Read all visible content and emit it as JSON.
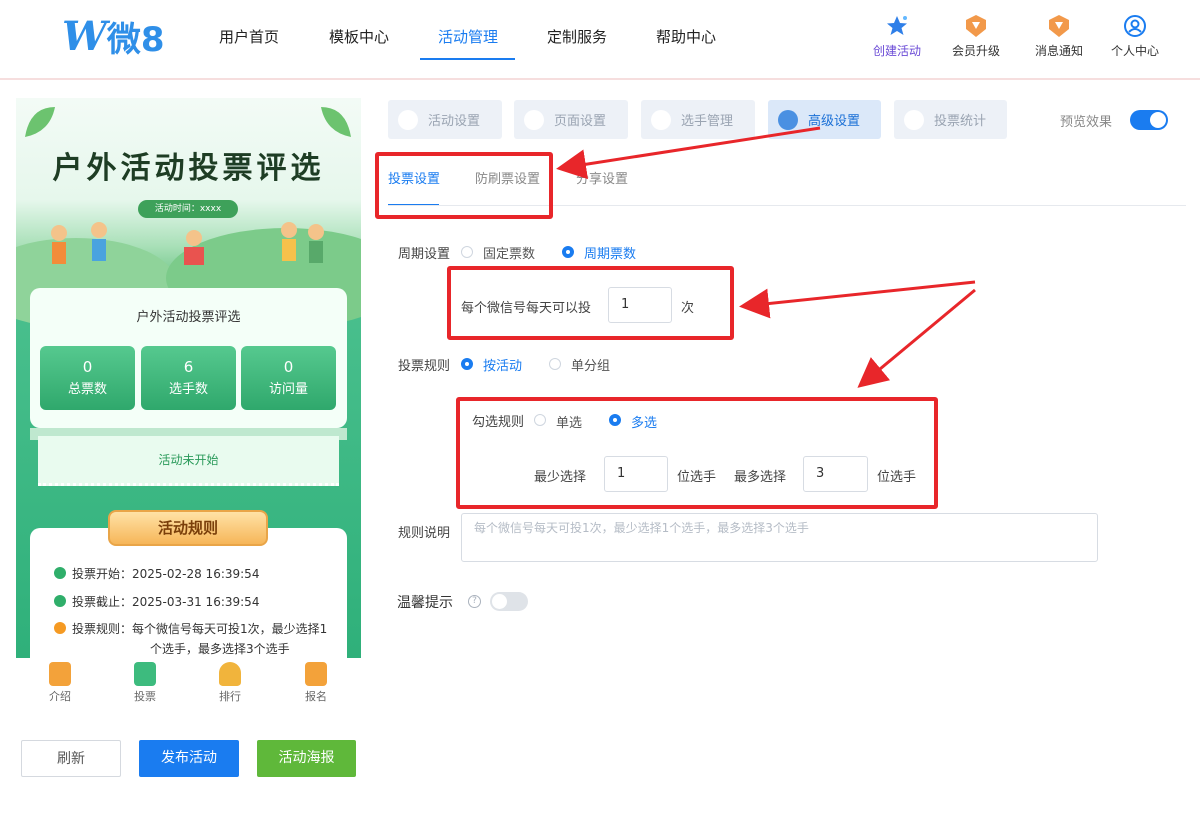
{
  "header": {
    "logo_w": "W",
    "logo_rest": "微8",
    "nav": [
      "用户首页",
      "模板中心",
      "活动管理",
      "定制服务",
      "帮助中心"
    ],
    "active_nav_index": 2,
    "actions": [
      "创建活动",
      "会员升级",
      "消息通知",
      "个人中心"
    ]
  },
  "preview": {
    "banner_title": "户外活动投票评选",
    "banner_time": "活动时间：xxxx",
    "card_title": "户外活动投票评选",
    "stats": [
      {
        "value": "0",
        "label": "总票数"
      },
      {
        "value": "6",
        "label": "选手数"
      },
      {
        "value": "0",
        "label": "访问量"
      }
    ],
    "status": "活动未开始",
    "rules_title": "活动规则",
    "rules": [
      {
        "text": "投票开始：2025-02-28 16:39:54",
        "color": "#2fae6a"
      },
      {
        "text": "投票截止：2025-03-31 16:39:54",
        "color": "#2fae6a"
      },
      {
        "text": "投票规则：每个微信号每天可投1次，最少选择1",
        "color": "#f59a23"
      },
      {
        "text": "个选手，最多选择3个选手",
        "color": ""
      }
    ],
    "tabbar": [
      "介绍",
      "投票",
      "排行",
      "报名"
    ]
  },
  "bottom_buttons": {
    "refresh": "刷新",
    "publish": "发布活动",
    "poster": "活动海报"
  },
  "settings": {
    "top_tabs": [
      "活动设置",
      "页面设置",
      "选手管理",
      "高级设置",
      "投票统计"
    ],
    "active_top_tab": 3,
    "preview_label": "预览效果",
    "preview_on": true,
    "sub_tabs": [
      "投票设置",
      "防刷票设置",
      "分享设置"
    ],
    "active_sub_tab": 0,
    "period_label": "周期设置",
    "period_options": [
      "固定票数",
      "周期票数"
    ],
    "period_selected": 1,
    "daily_label": "每个微信号每天可以投",
    "daily_value": "1",
    "daily_unit": "次",
    "rule_label": "投票规则",
    "rule_options": [
      "按活动",
      "单分组"
    ],
    "rule_selected": 0,
    "select_label": "勾选规则",
    "select_options": [
      "单选",
      "多选"
    ],
    "select_selected": 1,
    "min_label": "最少选择",
    "min_value": "1",
    "min_unit": "位选手",
    "max_label": "最多选择",
    "max_value": "3",
    "max_unit": "位选手",
    "desc_label": "规则说明",
    "desc_placeholder": "每个微信号每天可投1次，最少选择1个选手，最多选择3个选手",
    "tip_label": "温馨提示",
    "tip_on": false
  },
  "colors": {
    "primary": "#1a7cf0",
    "annotation_red": "#e8262a",
    "green_button": "#5fb83a"
  }
}
